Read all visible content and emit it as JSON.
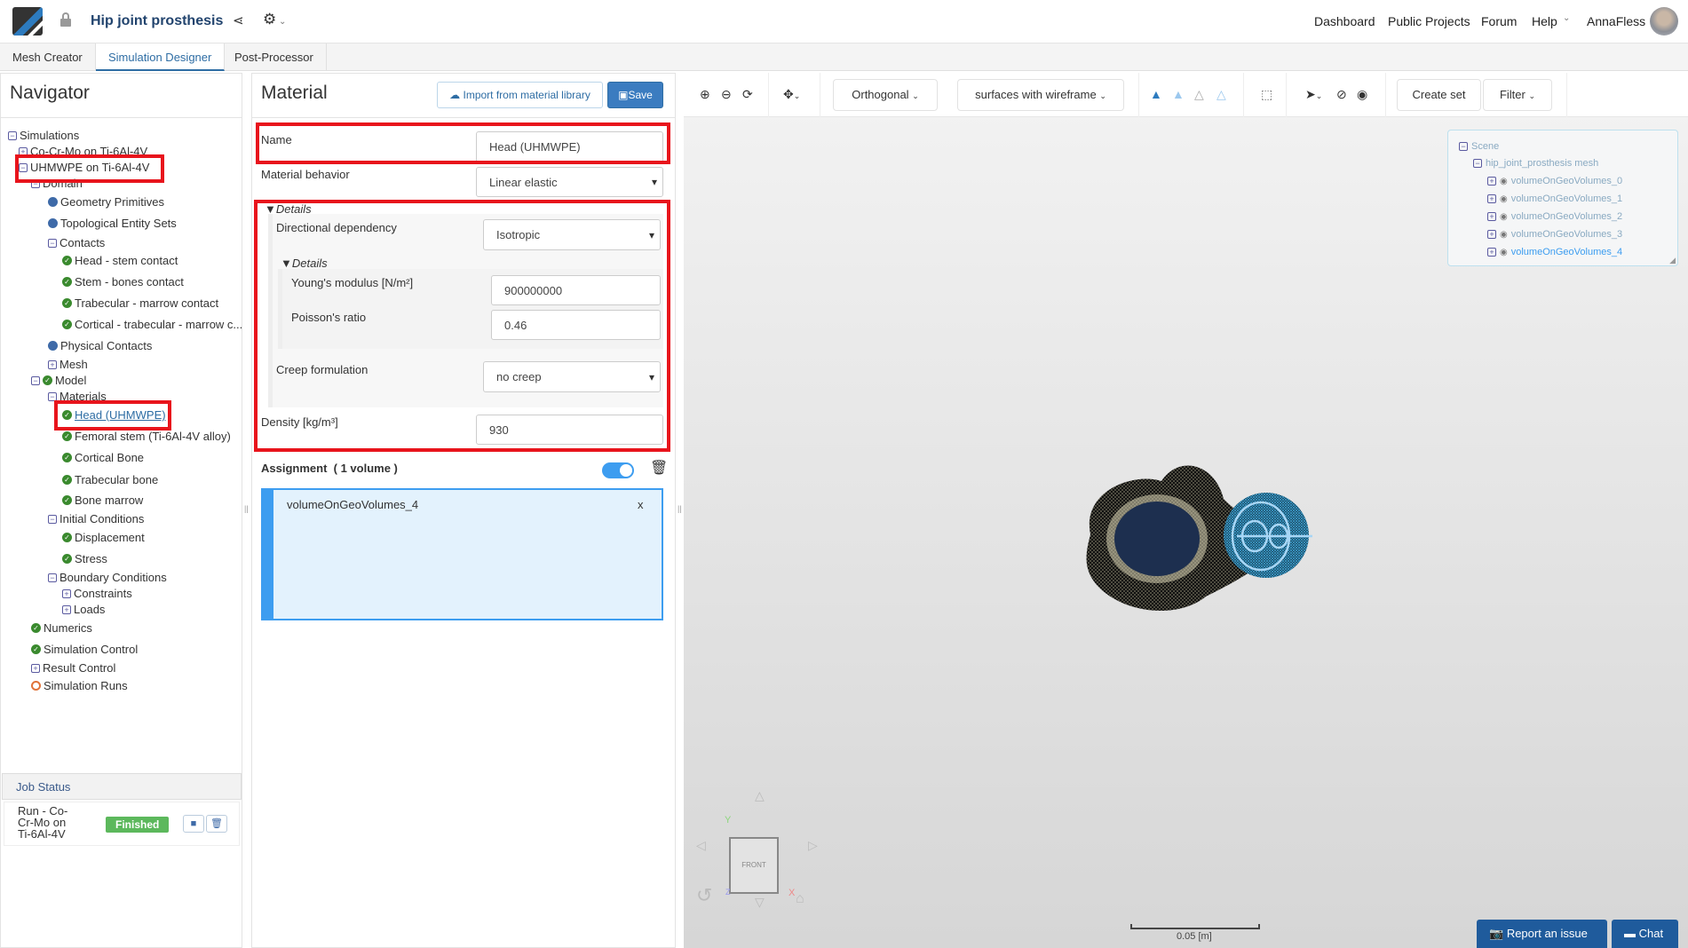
{
  "header": {
    "project_title": "Hip joint prosthesis",
    "nav_links": [
      "Dashboard",
      "Public Projects",
      "Forum",
      "Help"
    ],
    "username": "AnnaFless"
  },
  "tabs": [
    "Mesh Creator",
    "Simulation Designer",
    "Post-Processor"
  ],
  "navigator": {
    "title": "Navigator",
    "tree": [
      {
        "label": "Simulations",
        "icon": "minus"
      },
      {
        "label": "Co-Cr-Mo on Ti-6Al-4V",
        "icon": "plus"
      },
      {
        "label": "UHMWPE on Ti-6Al-4V",
        "icon": "minus"
      },
      {
        "label": "Domain",
        "icon": "minus"
      },
      {
        "label": "Geometry Primitives",
        "icon": "dot"
      },
      {
        "label": "Topological Entity Sets",
        "icon": "dot"
      },
      {
        "label": "Contacts",
        "icon": "minus"
      },
      {
        "label": "Head - stem contact",
        "icon": "check"
      },
      {
        "label": "Stem - bones contact",
        "icon": "check"
      },
      {
        "label": "Trabecular - marrow contact",
        "icon": "check"
      },
      {
        "label": "Cortical - trabecular - marrow c...",
        "icon": "check"
      },
      {
        "label": "Physical Contacts",
        "icon": "dot"
      },
      {
        "label": "Mesh",
        "icon": "plus"
      },
      {
        "label": "Model",
        "icon": "minus-check"
      },
      {
        "label": "Materials",
        "icon": "minus"
      },
      {
        "label": "Head (UHMWPE)",
        "icon": "check"
      },
      {
        "label": "Femoral stem (Ti-6Al-4V alloy)",
        "icon": "check"
      },
      {
        "label": "Cortical Bone",
        "icon": "check"
      },
      {
        "label": "Trabecular bone",
        "icon": "check"
      },
      {
        "label": "Bone marrow",
        "icon": "check"
      },
      {
        "label": "Initial Conditions",
        "icon": "minus"
      },
      {
        "label": "Displacement",
        "icon": "check"
      },
      {
        "label": "Stress",
        "icon": "check"
      },
      {
        "label": "Boundary Conditions",
        "icon": "minus"
      },
      {
        "label": "Constraints",
        "icon": "plus"
      },
      {
        "label": "Loads",
        "icon": "plus"
      },
      {
        "label": "Numerics",
        "icon": "check"
      },
      {
        "label": "Simulation Control",
        "icon": "check"
      },
      {
        "label": "Result Control",
        "icon": "plus"
      },
      {
        "label": "Simulation Runs",
        "icon": "ring"
      }
    ]
  },
  "job_status": {
    "title": "Job Status",
    "run_name": "Run - Co-Cr-Mo on Ti-6Al-4V",
    "status": "Finished"
  },
  "material": {
    "title": "Material",
    "import_label": "Import from material library",
    "save_label": "Save",
    "name_label": "Name",
    "name_value": "Head (UHMWPE)",
    "behavior_label": "Material behavior",
    "behavior_value": "Linear elastic",
    "details_label": "Details",
    "directional_label": "Directional dependency",
    "directional_value": "Isotropic",
    "details2_label": "Details",
    "youngs_label": "Young's modulus [N/m²]",
    "youngs_value": "900000000",
    "poisson_label": "Poisson's ratio",
    "poisson_value": "0.46",
    "creep_label": "Creep formulation",
    "creep_value": "no creep",
    "density_label": "Density [kg/m³]",
    "density_value": "930",
    "assignment_label": "Assignment  ( 1 volume )",
    "assignment_enabled": true,
    "assigned": [
      "volumeOnGeoVolumes_4"
    ],
    "remove_label": "x"
  },
  "viewer": {
    "projection": "Orthogonal",
    "render_mode": "surfaces with wireframe",
    "create_set": "Create set",
    "filter": "Filter",
    "scene": {
      "root": "Scene",
      "mesh": "hip_joint_prosthesis mesh",
      "volumes": [
        "volumeOnGeoVolumes_0",
        "volumeOnGeoVolumes_1",
        "volumeOnGeoVolumes_2",
        "volumeOnGeoVolumes_3",
        "volumeOnGeoVolumes_4"
      ]
    },
    "cube_label": "FRONT",
    "axes": {
      "x": "X",
      "y": "Y",
      "z": "Z"
    },
    "scale_label": "0.05 [m]"
  },
  "footer": {
    "report": "Report an issue",
    "chat": "Chat"
  }
}
